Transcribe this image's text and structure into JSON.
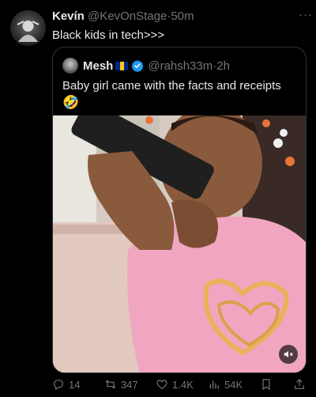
{
  "author": {
    "name": "Kevín",
    "handle": "@KevOnStage",
    "separator": "·",
    "time": "50m",
    "avatar_icon": "avatar-icon"
  },
  "tweet_text": "Black kids in tech>>>",
  "more_icon": "···",
  "quoted": {
    "name": "Mesh",
    "flag_icon": "barbados-flag-icon",
    "verified_icon": "verified-badge-icon",
    "handle": "@rahsh33m",
    "separator": "·",
    "time": "2h",
    "text": "Baby girl came with the facts and receipts",
    "emoji": "🤣",
    "media": {
      "type": "video",
      "sound_icon": "speaker-muted-icon"
    }
  },
  "actions": {
    "replies": "14",
    "reposts": "347",
    "likes": "1.4K",
    "views": "54K"
  },
  "colors": {
    "background": "#000000",
    "text": "#e7e9ea",
    "muted": "#71767b",
    "border": "#2f3336",
    "verified": "#1d9bf0"
  }
}
